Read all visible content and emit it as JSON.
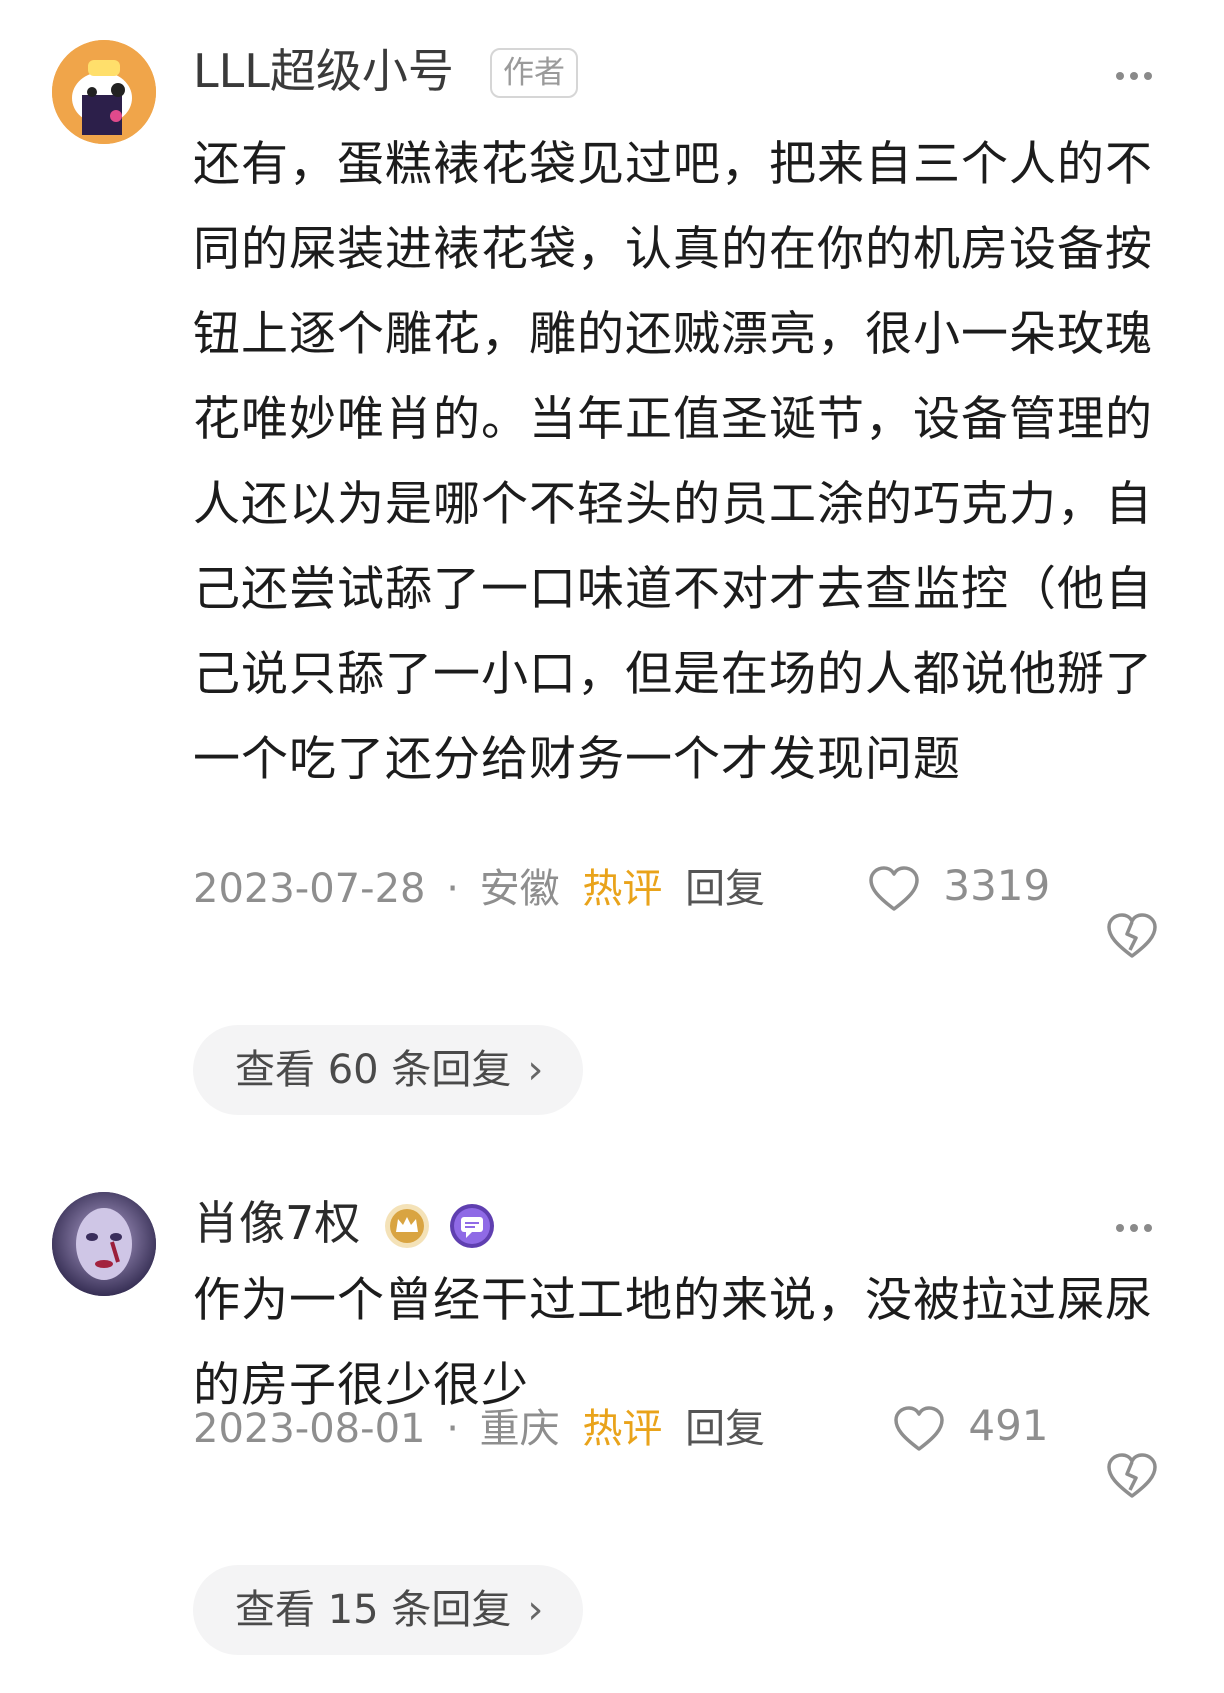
{
  "comments": [
    {
      "username": "LLL超级小号",
      "author_badge": "作者",
      "more_icon": "more-dots-icon",
      "text": "还有，蛋糕裱花袋见过吧，把来自三个人的不同的屎装进裱花袋，认真的在你的机房设备按钮上逐个雕花，雕的还贼漂亮，很小一朵玫瑰花唯妙唯肖的。当年正值圣诞节，设备管理的人还以为是哪个不轻头的员工涂的巧克力，自己还尝试舔了一口味道不对才去查监控（他自己说只舔了一小口，但是在场的人都说他掰了一个吃了还分给财务一个才发现问题",
      "date": "2023-07-28",
      "separator": "·",
      "location": "安徽",
      "hot_label": "热评",
      "reply_label": "回复",
      "like_count": "3319",
      "view_replies": "查看 60 条回复"
    },
    {
      "username": "肖像7权",
      "more_icon": "more-dots-icon",
      "text": "作为一个曾经干过工地的来说，没被拉过屎尿的房子很少很少",
      "date": "2023-08-01",
      "separator": "·",
      "location": "重庆",
      "hot_label": "热评",
      "reply_label": "回复",
      "like_count": "491",
      "view_replies": "查看 15 条回复"
    }
  ],
  "colors": {
    "hot": "#e9a31a",
    "meta": "#8e8e8e",
    "pill_bg": "#f4f4f5",
    "crown_badge": "#d9a441",
    "chat_badge": "#7c4fd6"
  }
}
